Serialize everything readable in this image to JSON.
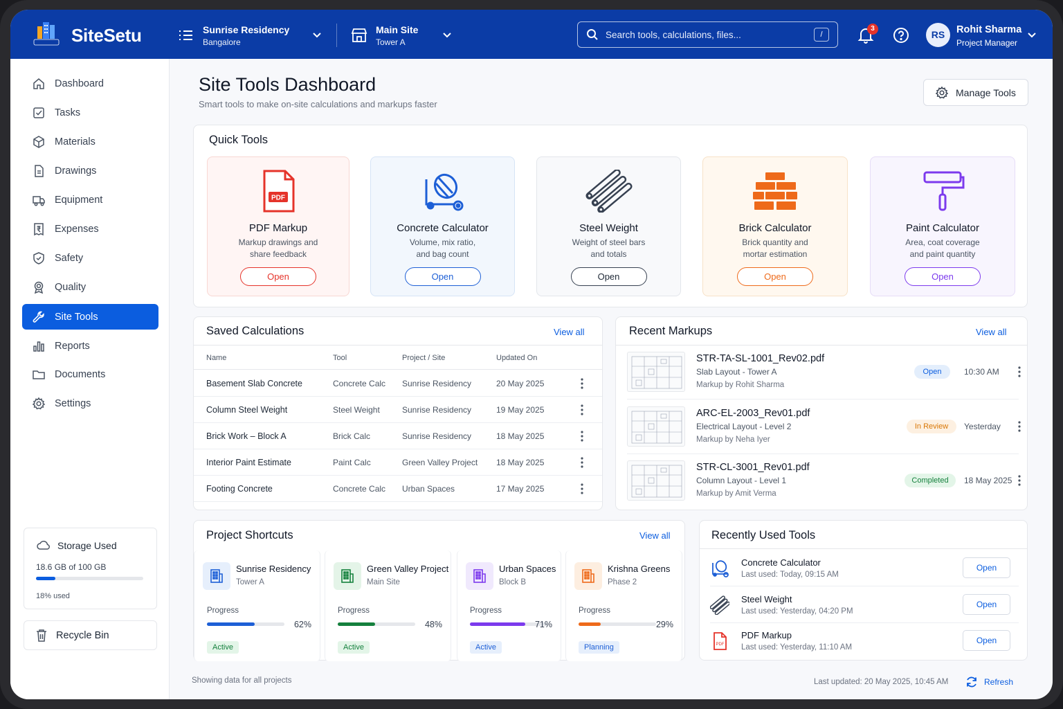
{
  "header": {
    "brand": "SiteSetu",
    "project": {
      "name": "Sunrise Residency",
      "location": "Bangalore"
    },
    "site": {
      "name": "Main Site",
      "sub": "Tower A"
    },
    "search": {
      "placeholder": "Search tools, calculations, files...",
      "shortcut": "/"
    },
    "notifications_count": "3",
    "user": {
      "initials": "RS",
      "name": "Rohit Sharma",
      "role": "Project Manager"
    },
    "colors": {
      "primary": "#0b3ca6",
      "accent": "#0b5ddf"
    }
  },
  "sidebar": {
    "items": [
      {
        "label": "Dashboard",
        "icon": "home-icon"
      },
      {
        "label": "Tasks",
        "icon": "checkbox-icon"
      },
      {
        "label": "Materials",
        "icon": "box-icon"
      },
      {
        "label": "Drawings",
        "icon": "file-icon"
      },
      {
        "label": "Equipment",
        "icon": "truck-icon"
      },
      {
        "label": "Expenses",
        "icon": "rupee-receipt-icon"
      },
      {
        "label": "Safety",
        "icon": "shield-icon"
      },
      {
        "label": "Quality",
        "icon": "badge-icon"
      },
      {
        "label": "Site Tools",
        "icon": "wrench-icon",
        "active": true
      },
      {
        "label": "Reports",
        "icon": "bar-chart-icon"
      },
      {
        "label": "Documents",
        "icon": "folder-icon"
      },
      {
        "label": "Settings",
        "icon": "gear-icon"
      }
    ],
    "storage": {
      "title": "Storage Used",
      "amount": "18.6 GB of 100 GB",
      "percent_label": "18% used",
      "fraction": 0.18
    },
    "recycle_bin": "Recycle Bin"
  },
  "page": {
    "title": "Site Tools Dashboard",
    "subtitle": "Smart tools to make on-site calculations and markups faster",
    "manage_tools": "Manage Tools"
  },
  "quick_tools": {
    "title": "Quick Tools",
    "tools": [
      {
        "name": "PDF Markup",
        "desc1": "Markup drawings and",
        "desc2": "share feedback",
        "button": "Open",
        "color": "#e5332a"
      },
      {
        "name": "Concrete Calculator",
        "desc1": "Volume, mix ratio,",
        "desc2": "and bag count",
        "button": "Open",
        "color": "#1d5fd6"
      },
      {
        "name": "Steel Weight",
        "desc1": "Weight of steel bars",
        "desc2": "and totals",
        "button": "Open",
        "color": "#374151"
      },
      {
        "name": "Brick Calculator",
        "desc1": "Brick quantity and",
        "desc2": "mortar estimation",
        "button": "Open",
        "color": "#ee6a1a"
      },
      {
        "name": "Paint Calculator",
        "desc1": "Area, coat coverage",
        "desc2": "and paint quantity",
        "button": "Open",
        "color": "#7c3aed"
      }
    ]
  },
  "saved_calculations": {
    "title": "Saved Calculations",
    "view_all": "View all",
    "columns": [
      "Name",
      "Tool",
      "Project / Site",
      "Updated On"
    ],
    "rows": [
      {
        "name": "Basement Slab Concrete",
        "tool": "Concrete Calc",
        "project": "Sunrise Residency",
        "updated": "20 May 2025"
      },
      {
        "name": "Column Steel Weight",
        "tool": "Steel Weight",
        "project": "Sunrise Residency",
        "updated": "19 May 2025"
      },
      {
        "name": "Brick Work – Block A",
        "tool": "Brick Calc",
        "project": "Sunrise Residency",
        "updated": "18 May 2025"
      },
      {
        "name": "Interior Paint Estimate",
        "tool": "Paint Calc",
        "project": "Green Valley Project",
        "updated": "18 May 2025"
      },
      {
        "name": "Footing Concrete",
        "tool": "Concrete Calc",
        "project": "Urban Spaces",
        "updated": "17 May 2025"
      }
    ]
  },
  "recent_markups": {
    "title": "Recent Markups",
    "view_all": "View all",
    "items": [
      {
        "file": "STR-TA-SL-1001_Rev02.pdf",
        "sub": "Slab Layout - Tower A",
        "by": "Markup by Rohit Sharma",
        "status": "Open",
        "time": "10:30 AM"
      },
      {
        "file": "ARC-EL-2003_Rev01.pdf",
        "sub": "Electrical Layout - Level 2",
        "by": "Markup by Neha Iyer",
        "status": "In Review",
        "time": "Yesterday"
      },
      {
        "file": "STR-CL-3001_Rev01.pdf",
        "sub": "Column Layout - Level 1",
        "by": "Markup by Amit Verma",
        "status": "Completed",
        "time": "18 May 2025"
      }
    ]
  },
  "project_shortcuts": {
    "title": "Project Shortcuts",
    "view_all": "View all",
    "progress_label": "Progress",
    "projects": [
      {
        "name": "Sunrise Residency",
        "sub": "Tower A",
        "progress": 62,
        "progress_label": "62%",
        "status": "Active"
      },
      {
        "name": "Green Valley Project",
        "sub": "Main Site",
        "progress": 48,
        "progress_label": "48%",
        "status": "Active"
      },
      {
        "name": "Urban Spaces",
        "sub": "Block B",
        "progress": 71,
        "progress_label": "71%",
        "status": "Active"
      },
      {
        "name": "Krishna Greens",
        "sub": "Phase 2",
        "progress": 29,
        "progress_label": "29%",
        "status": "Planning"
      }
    ]
  },
  "recently_used": {
    "title": "Recently Used Tools",
    "items": [
      {
        "name": "Concrete Calculator",
        "last": "Last used: Today, 09:15 AM",
        "button": "Open"
      },
      {
        "name": "Steel Weight",
        "last": "Last used: Yesterday, 04:20 PM",
        "button": "Open"
      },
      {
        "name": "PDF Markup",
        "last": "Last used: Yesterday, 11:10 AM",
        "button": "Open"
      }
    ]
  },
  "footer": {
    "left": "Showing data for all projects",
    "updated": "Last updated: 20 May 2025, 10:45 AM",
    "refresh": "Refresh"
  }
}
